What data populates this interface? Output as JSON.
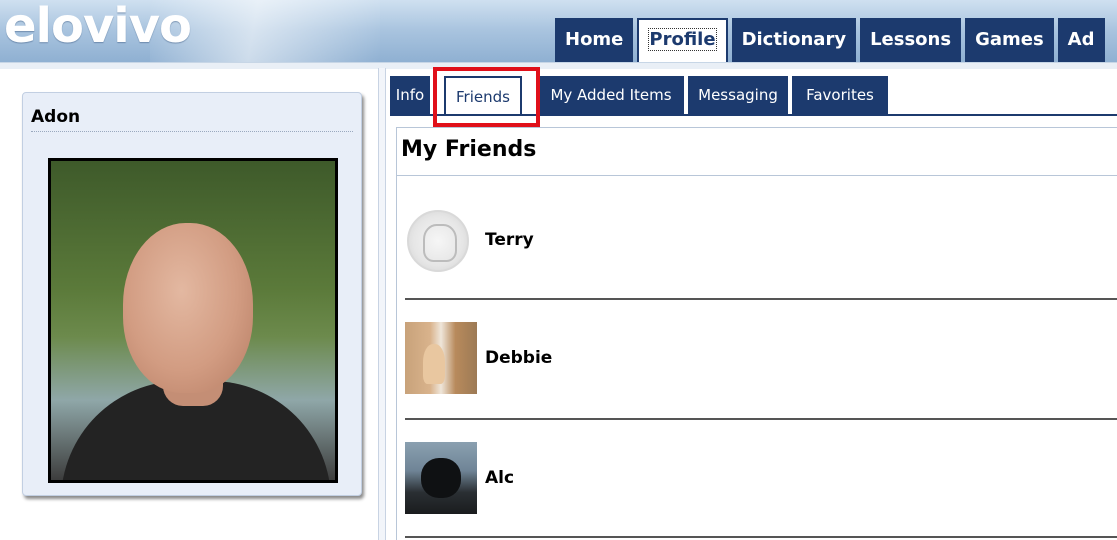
{
  "header": {
    "logo_text": "elovivo",
    "nav": [
      {
        "label": "Home"
      },
      {
        "label": "Profile",
        "active": true
      },
      {
        "label": "Dictionary"
      },
      {
        "label": "Lessons"
      },
      {
        "label": "Games"
      },
      {
        "label": "Ad"
      }
    ]
  },
  "profile": {
    "name": "Adon"
  },
  "subtabs": [
    {
      "label": "Info"
    },
    {
      "label": "Friends",
      "active": true
    },
    {
      "label": "My Added Items"
    },
    {
      "label": "Messaging"
    },
    {
      "label": "Favorites"
    }
  ],
  "friends_section": {
    "title": "My Friends",
    "friends": [
      {
        "name": "Terry",
        "avatar": "default-avatar-icon"
      },
      {
        "name": "Debbie",
        "avatar": "photo"
      },
      {
        "name": "Alc",
        "avatar": "photo"
      }
    ]
  },
  "colors": {
    "nav_bg": "#1c3a6e",
    "highlight": "#e0101a",
    "panel_bg": "#e8eef8"
  }
}
